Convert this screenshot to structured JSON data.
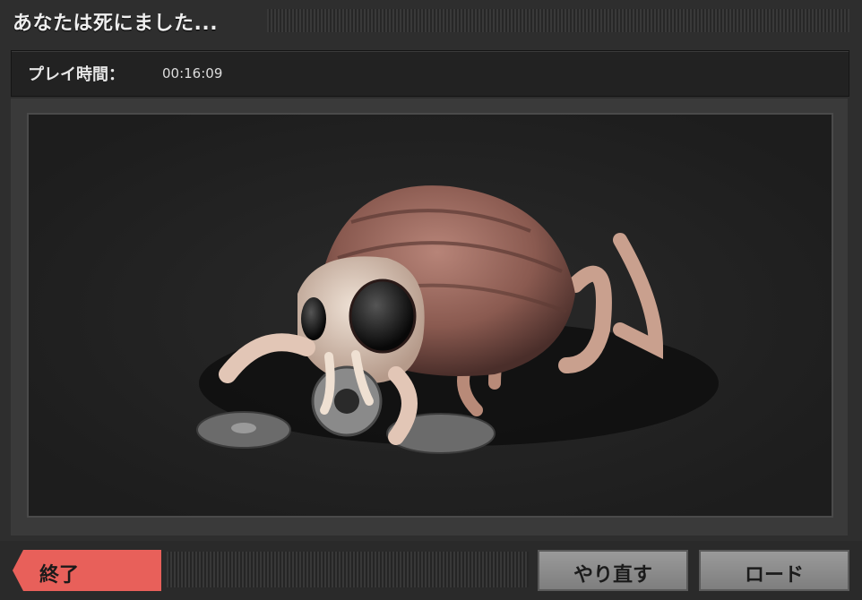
{
  "window": {
    "title": "あなたは死にました..."
  },
  "playtime": {
    "label": "プレイ時間：",
    "value": "00:16:09"
  },
  "scene": {
    "subject": "creature-image",
    "accent_color": "#e8605a"
  },
  "buttons": {
    "quit_label": "終了",
    "retry_label": "やり直す",
    "load_label": "ロード"
  }
}
